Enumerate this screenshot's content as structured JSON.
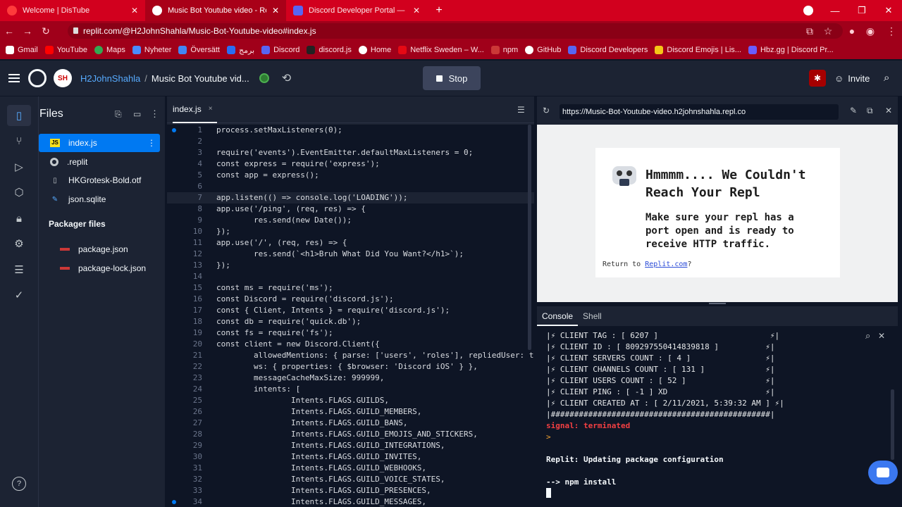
{
  "browser": {
    "tabs": [
      {
        "title": "Welcome | DisTube",
        "active": false
      },
      {
        "title": "Music Bot Youtube video - Replit",
        "active": true
      },
      {
        "title": "Discord Developer Portal — My",
        "active": false
      }
    ],
    "address": "replit.com/@H2JohnShahla/Music-Bot-Youtube-video#index.js",
    "bookmarks": [
      "Gmail",
      "YouTube",
      "Maps",
      "Nyheter",
      "Översätt",
      "برمج",
      "Discord",
      "discord.js",
      "Home",
      "Netflix Sweden – W...",
      "npm",
      "GitHub",
      "Discord Developers",
      "Discord Emojis | Lis...",
      "Hbz.gg | Discord Pr..."
    ]
  },
  "header": {
    "avatar": "SH",
    "user": "H2JohnShahla",
    "separator": "/",
    "repl": "Music Bot Youtube vid...",
    "stop_label": "Stop",
    "invite_label": "Invite"
  },
  "files": {
    "title": "Files",
    "items": [
      "index.js",
      ".replit",
      "HKGrotesk-Bold.otf",
      "json.sqlite"
    ],
    "packager_title": "Packager files",
    "packager_items": [
      "package.json",
      "package-lock.json"
    ]
  },
  "editor": {
    "tab": "index.js",
    "tab_close": "×",
    "lines": [
      "process.setMaxListeners(0);",
      "",
      "require('events').EventEmitter.defaultMaxListeners = 0;",
      "const express = require('express');",
      "const app = express();",
      "",
      "app.listen(() => console.log('LOADING'));",
      "app.use('/ping', (req, res) => {",
      "        res.send(new Date());",
      "});",
      "app.use('/', (req, res) => {",
      "        res.send(`<h1>Bruh What Did You Want?</h1>`);",
      "});",
      "",
      "const ms = require('ms');",
      "const Discord = require('discord.js');",
      "const { Client, Intents } = require('discord.js');",
      "const db = require('quick.db');",
      "const fs = require('fs');",
      "const client = new Discord.Client({",
      "        allowedMentions: { parse: ['users', 'roles'], repliedUser: tru",
      "        ws: { properties: { $browser: 'Discord iOS' } },",
      "        messageCacheMaxSize: 999999,",
      "        intents: [",
      "                Intents.FLAGS.GUILDS,",
      "                Intents.FLAGS.GUILD_MEMBERS,",
      "                Intents.FLAGS.GUILD_BANS,",
      "                Intents.FLAGS.GUILD_EMOJIS_AND_STICKERS,",
      "                Intents.FLAGS.GUILD_INTEGRATIONS,",
      "                Intents.FLAGS.GUILD_INVITES,",
      "                Intents.FLAGS.GUILD_WEBHOOKS,",
      "                Intents.FLAGS.GUILD_VOICE_STATES,",
      "                Intents.FLAGS.GUILD_PRESENCES,",
      "                Intents.FLAGS.GUILD_MESSAGES,"
    ]
  },
  "webview": {
    "url": "https://Music-Bot-Youtube-video.h2johnshahla.repl.co",
    "heading_line1": "Hmmmm.... We Couldn't",
    "heading_line2": "Reach Your Repl",
    "body_line1": "Make sure your repl has a",
    "body_line2": "port open and is ready to",
    "body_line3": "receive HTTP traffic.",
    "return_prefix": "Return to ",
    "return_link": "Replit.com",
    "return_suffix": "?"
  },
  "console": {
    "tabs": [
      "Console",
      "Shell"
    ],
    "lines": [
      "|⚡ CLIENT TAG : [ 6207 ]                        ⚡|",
      "|⚡ CLIENT ID : [ 809297550414839818 ]          ⚡|",
      "|⚡ CLIENT SERVERS COUNT : [ 4 ]                ⚡|",
      "|⚡ CLIENT CHANNELS COUNT : [ 131 ]             ⚡|",
      "|⚡ CLIENT USERS COUNT : [ 52 ]                 ⚡|",
      "|⚡ CLIENT PING : [ -1 ] XD                     ⚡|",
      "|⚡ CLIENT CREATED AT : [ 2/11/2021, 5:39:32 AM ] ⚡|",
      "|###############################################|",
      "signal: terminated",
      ">",
      "",
      "Replit: Updating package configuration",
      "",
      "--> npm install"
    ]
  },
  "colors": {
    "accent": "#0079f2",
    "error": "#f23f42",
    "browser_red": "#d2001e"
  }
}
